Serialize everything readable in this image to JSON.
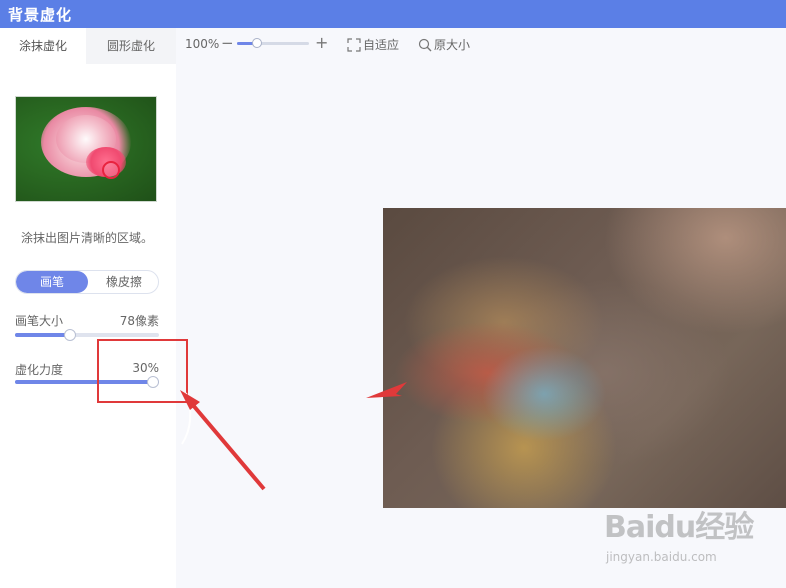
{
  "app": {
    "title": "背景虚化"
  },
  "tabs": [
    {
      "label": "涂抹虚化"
    },
    {
      "label": "圆形虚化"
    }
  ],
  "panel": {
    "hint": "涂抹出图片清晰的区域。",
    "mode_toggle": {
      "brush": "画笔",
      "eraser": "橡皮擦",
      "selected": "画笔"
    },
    "brush_size": {
      "label": "画笔大小",
      "value_text": "78像素",
      "level": 0.38
    },
    "blur_strength": {
      "label": "虚化力度",
      "value_text": "30%",
      "level": 1.0
    }
  },
  "toolbar": {
    "zoom_text": "100%",
    "zoom_minus": "−",
    "zoom_plus": "+",
    "zoom_level": 0.28,
    "fit_label": "自适应",
    "original_label": "原大小"
  },
  "watermark": {
    "main": "Baidu经验",
    "sub": "jingyan.baidu.com"
  },
  "colors": {
    "accent": "#6f86e8",
    "titlebar": "#5b7fe6",
    "annotation": "#e0393a"
  }
}
